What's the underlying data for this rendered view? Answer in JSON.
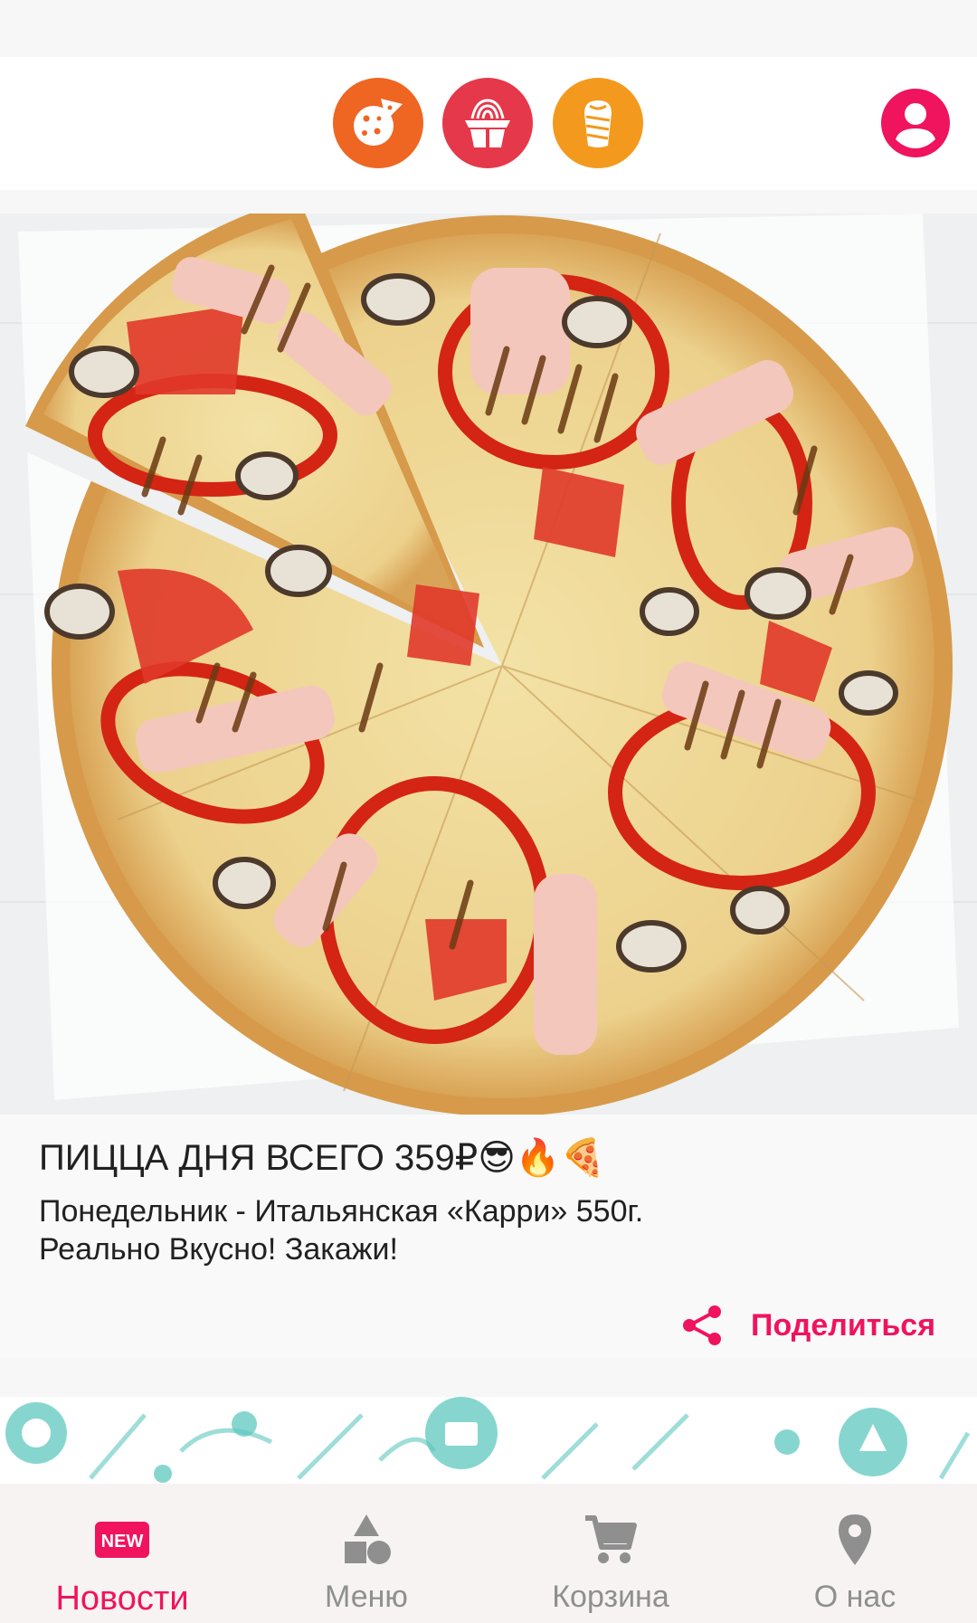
{
  "colors": {
    "accent": "#f0135e",
    "pizza_category": "#ef6522",
    "wok_category": "#e5384a",
    "shawarma_category": "#f39a1e",
    "nav_inactive": "#8f8f8f"
  },
  "header": {
    "categories": [
      {
        "icon": "pizza-icon"
      },
      {
        "icon": "noodle-box-icon"
      },
      {
        "icon": "shawarma-icon"
      }
    ],
    "profile_icon": "account-circle-icon"
  },
  "news": {
    "image_icon": "pizza-photo",
    "title": "ПИЦЦА ДНЯ ВСЕГО 359₽😎🔥🍕",
    "body": "Понедельник - Итальянская «Карри» 550г.\nРеально Вкусно! Закажи!",
    "share_label": "Поделиться",
    "share_icon": "share-icon"
  },
  "banner": {
    "icon": "grill-master-pattern"
  },
  "bottom_nav": {
    "items": [
      {
        "label": "Новости",
        "icon": "new-badge-icon",
        "badge": "NEW",
        "active": true
      },
      {
        "label": "Меню",
        "icon": "shapes-icon",
        "active": false
      },
      {
        "label": "Корзина",
        "icon": "cart-icon",
        "active": false
      },
      {
        "label": "О нас",
        "icon": "location-pin-icon",
        "active": false
      }
    ]
  }
}
